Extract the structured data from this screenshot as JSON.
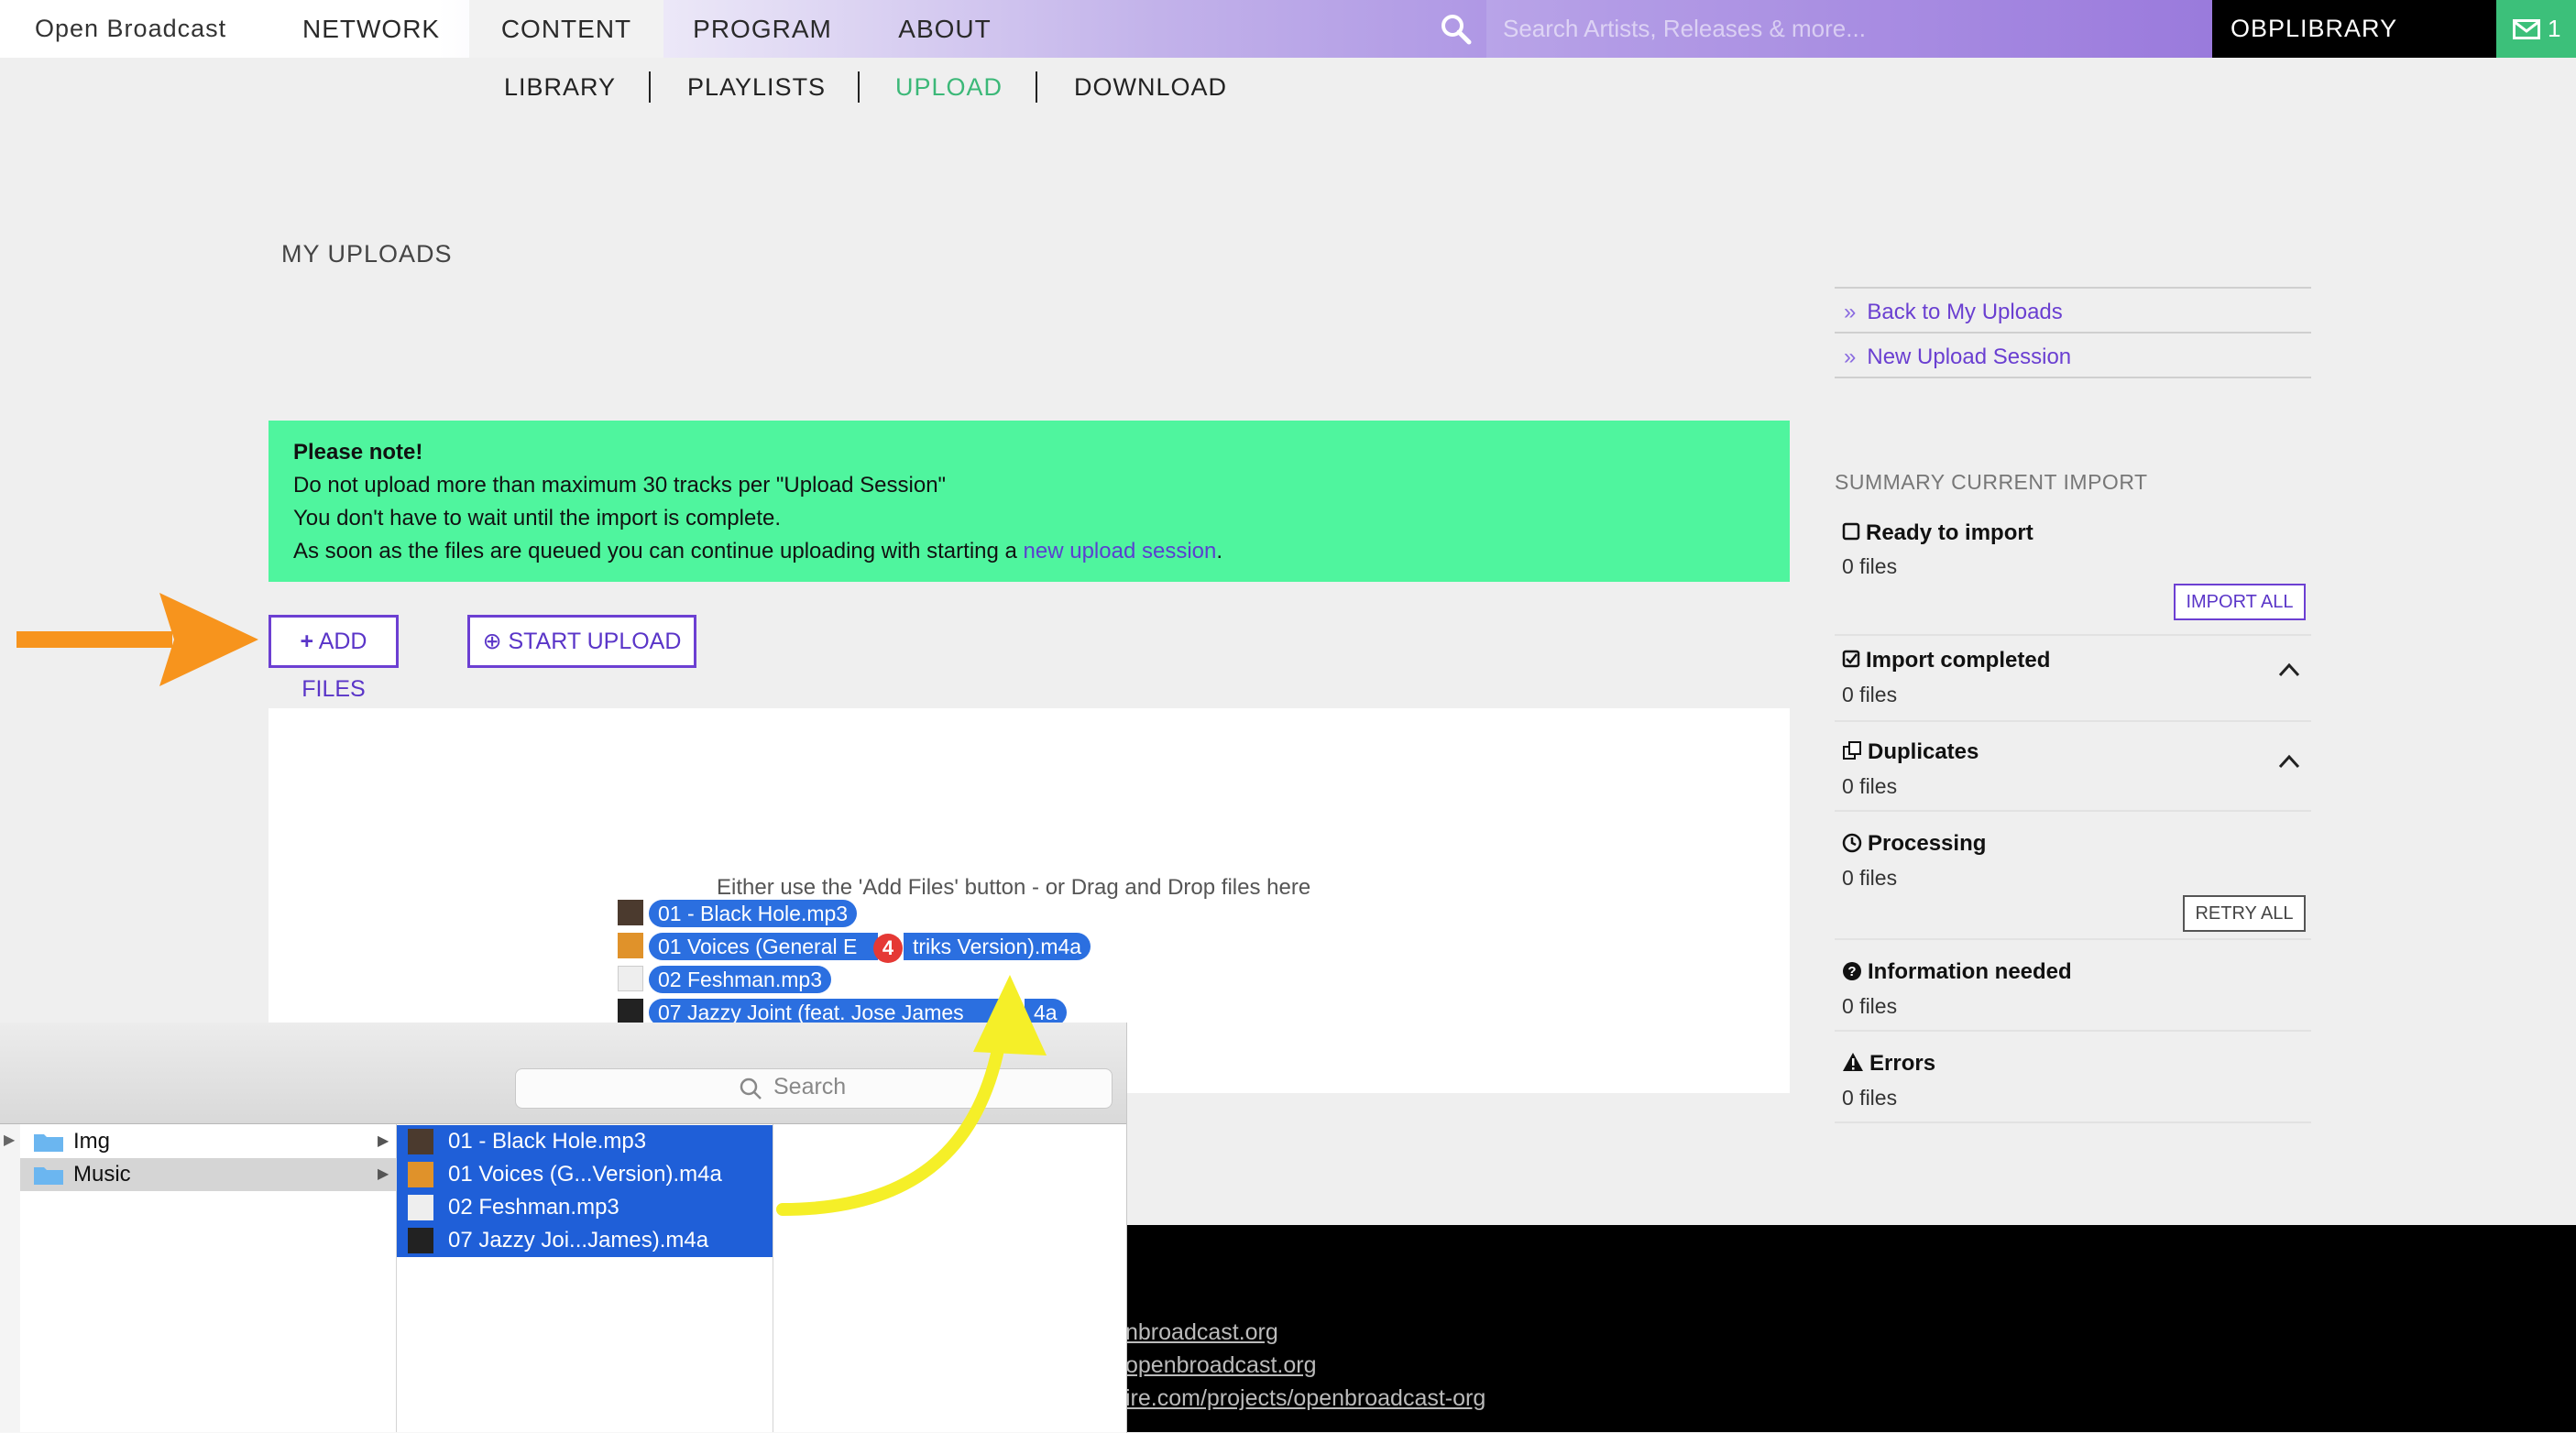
{
  "nav": {
    "brand": "Open Broadcast",
    "items": [
      "NETWORK",
      "CONTENT",
      "PROGRAM",
      "ABOUT"
    ],
    "search_placeholder": "Search Artists, Releases & more...",
    "library_label": "OBPLIBRARY",
    "message_count": "1"
  },
  "subnav": {
    "items": [
      "LIBRARY",
      "PLAYLISTS",
      "UPLOAD",
      "DOWNLOAD"
    ],
    "active": "UPLOAD"
  },
  "page": {
    "title": "MY UPLOADS"
  },
  "right_links": [
    "Back to My Uploads",
    "New Upload Session"
  ],
  "note": {
    "heading": "Please note!",
    "line1": "Do not upload more than maximum 30 tracks per \"Upload Session\"",
    "line2": "You don't have to wait until the import is complete.",
    "line3_prefix": "As soon as the files are queued you can continue uploading with starting a ",
    "line3_link": "new upload session",
    "line3_suffix": "."
  },
  "buttons": {
    "add_files": "ADD FILES",
    "start_upload": "START UPLOAD"
  },
  "dropzone": {
    "hint": "Either use the 'Add Files' button - or Drag and Drop files here",
    "dragged_files": [
      "01 - Black Hole.mp3",
      "01 Voices (General E",
      "triks Version).m4a",
      "02 Feshman.mp3",
      "07 Jazzy Joint (feat. Jose James",
      "4a"
    ],
    "drag_count": "4"
  },
  "summary": {
    "title": "SUMMARY CURRENT IMPORT",
    "sections": [
      {
        "label": "Ready to import",
        "count": "0 files",
        "button": "IMPORT ALL"
      },
      {
        "label": "Import completed",
        "count": "0 files"
      },
      {
        "label": "Duplicates",
        "count": "0 files"
      },
      {
        "label": "Processing",
        "count": "0 files",
        "button": "RETRY ALL"
      },
      {
        "label": "Information needed",
        "count": "0 files"
      },
      {
        "label": "Errors",
        "count": "0 files"
      }
    ]
  },
  "footer": {
    "links": [
      "nbroadcast.org",
      "openbroadcast.org",
      "ire.com/projects/openbroadcast-org"
    ]
  },
  "finder": {
    "search_placeholder": "Search",
    "folders": [
      "Img",
      "Music"
    ],
    "files": [
      "01 - Black Hole.mp3",
      "01 Voices (G...Version).m4a",
      "02 Feshman.mp3",
      "07 Jazzy Joi...James).m4a"
    ]
  },
  "colors": {
    "accent_purple": "#6c3fd2",
    "note_green": "#4ff59e",
    "active_subnav": "#3cb878",
    "selection_blue": "#1f5fd8",
    "arrow_orange": "#f7941d",
    "arrow_yellow": "#f5ef28"
  },
  "icons": [
    "search-icon",
    "envelope-icon",
    "plus-icon",
    "upload-circle-icon",
    "double-chevron-icon",
    "checkbox-empty-icon",
    "checkbox-checked-icon",
    "duplicate-icon",
    "clock-icon",
    "question-circle-icon",
    "warning-icon",
    "caret-up-icon",
    "folder-icon"
  ]
}
